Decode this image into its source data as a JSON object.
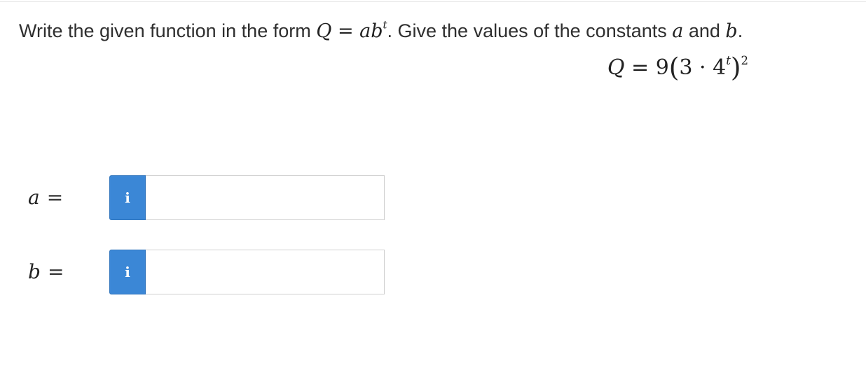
{
  "question": {
    "prefix": "Write the given function in the form ",
    "form_Q": "Q",
    "form_eq": " = ",
    "form_ab": "ab",
    "form_exp": "t",
    "middle": ". Give the values of the constants ",
    "const_a": "a",
    "and_text": " and ",
    "const_b": "b",
    "suffix": "."
  },
  "formula": {
    "lhs": "Q",
    "eq": " = ",
    "coef": "9",
    "open_paren": "(",
    "inner_base": "3 · 4",
    "inner_exp": "t",
    "close_paren": ")",
    "outer_exp": "2"
  },
  "answers": [
    {
      "var": "a",
      "eq": "=",
      "info_icon": "i",
      "value": "",
      "placeholder": ""
    },
    {
      "var": "b",
      "eq": "=",
      "info_icon": "i",
      "value": "",
      "placeholder": ""
    }
  ],
  "colors": {
    "info_button": "#3b87d6",
    "input_border": "#cfcfcf"
  },
  "icons": {
    "info": "info-icon"
  }
}
